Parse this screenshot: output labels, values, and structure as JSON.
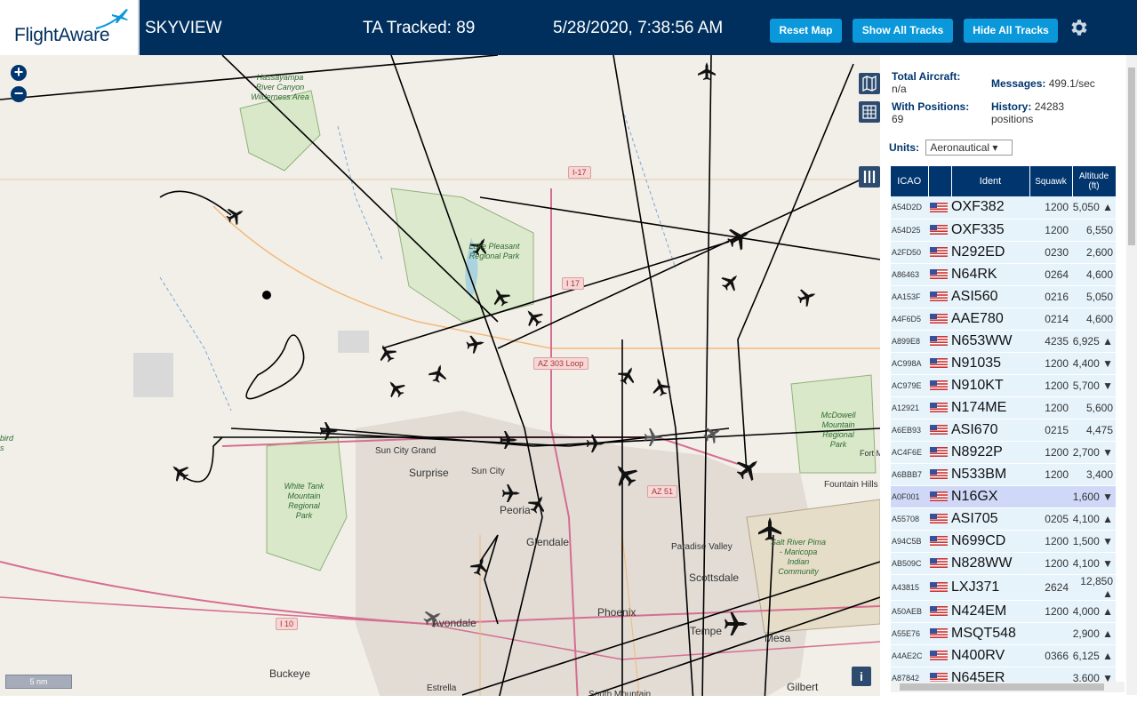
{
  "header": {
    "logo_text": "FlightAware",
    "app_title": "SKYVIEW",
    "ta_tracked": "TA Tracked: 89",
    "datetime": "5/28/2020, 7:38:56 AM",
    "reset_label": "Reset Map",
    "show_tracks_label": "Show All Tracks",
    "hide_tracks_label": "Hide All Tracks",
    "settings_icon": "gear-icon"
  },
  "map": {
    "zoom_in": "+",
    "zoom_out": "−",
    "scale": "5 nm",
    "info": "i",
    "shields": [
      "I-17",
      "I 17",
      "AZ 303 Loop",
      "AZ 51",
      "I 10"
    ],
    "places": [
      "Sun City Grand",
      "Surprise",
      "Sun City",
      "Peoria",
      "Glendale",
      "Paradise Valley",
      "Scottsdale",
      "Phoenix",
      "Avondale",
      "Tempe",
      "Mesa",
      "Gilbert",
      "Buckeye",
      "Fountain Hills",
      "Fort M",
      "Estrella",
      "South Mountain"
    ],
    "parks": [
      "Hassayampa River Canyon Wilderness Area",
      "Lake Pleasant Regional Park",
      "White Tank Mountain Regional Park",
      "McDowell Mountain Regional Park",
      "Salt River Pima - Maricopa Indian Community",
      "bird s"
    ]
  },
  "stats": {
    "total_aircraft_label": "Total Aircraft:",
    "total_aircraft_value": "n/a",
    "with_positions_label": "With Positions:",
    "with_positions_value": "69",
    "messages_label": "Messages:",
    "messages_value": "499.1/sec",
    "history_label": "History:",
    "history_value": "24283",
    "history_unit": "positions",
    "units_label": "Units:",
    "units_value": "Aeronautical ▾"
  },
  "table": {
    "headers": [
      "ICAO",
      "",
      "Ident",
      "Squawk",
      "Altitude (ft)"
    ],
    "rows": [
      {
        "icao": "A54D2D",
        "ident": "OXF382",
        "squawk": "1200",
        "alt": "5,050 ▲"
      },
      {
        "icao": "A54D25",
        "ident": "OXF335",
        "squawk": "1200",
        "alt": "6,550"
      },
      {
        "icao": "A2FD50",
        "ident": "N292ED",
        "squawk": "0230",
        "alt": "2,600"
      },
      {
        "icao": "A86463",
        "ident": "N64RK",
        "squawk": "0264",
        "alt": "4,600"
      },
      {
        "icao": "AA153F",
        "ident": "ASI560",
        "squawk": "0216",
        "alt": "5,050"
      },
      {
        "icao": "A4F6D5",
        "ident": "AAE780",
        "squawk": "0214",
        "alt": "4,600"
      },
      {
        "icao": "A899E8",
        "ident": "N653WW",
        "squawk": "4235",
        "alt": "6,925 ▲"
      },
      {
        "icao": "AC998A",
        "ident": "N91035",
        "squawk": "1200",
        "alt": "4,400 ▼"
      },
      {
        "icao": "AC979E",
        "ident": "N910KT",
        "squawk": "1200",
        "alt": "5,700 ▼"
      },
      {
        "icao": "A12921",
        "ident": "N174ME",
        "squawk": "1200",
        "alt": "5,600"
      },
      {
        "icao": "A6EB93",
        "ident": "ASI670",
        "squawk": "0215",
        "alt": "4,475"
      },
      {
        "icao": "AC4F6E",
        "ident": "N8922P",
        "squawk": "1200",
        "alt": "2,700 ▼"
      },
      {
        "icao": "A6BBB7",
        "ident": "N533BM",
        "squawk": "1200",
        "alt": "3,400"
      },
      {
        "icao": "A0F001",
        "ident": "N16GX",
        "squawk": "",
        "alt": "1,600 ▼",
        "selected": true
      },
      {
        "icao": "A55708",
        "ident": "ASI705",
        "squawk": "0205",
        "alt": "4,100 ▲"
      },
      {
        "icao": "A94C5B",
        "ident": "N699CD",
        "squawk": "1200",
        "alt": "1,500 ▼"
      },
      {
        "icao": "AB509C",
        "ident": "N828WW",
        "squawk": "1200",
        "alt": "4,100 ▼"
      },
      {
        "icao": "A43815",
        "ident": "LXJ371",
        "squawk": "2624",
        "alt": "12,850 ▲"
      },
      {
        "icao": "A50AEB",
        "ident": "N424EM",
        "squawk": "1200",
        "alt": "4,000 ▲"
      },
      {
        "icao": "A55E76",
        "ident": "MSQT548",
        "squawk": "",
        "alt": "2,900 ▲"
      },
      {
        "icao": "A4AE2C",
        "ident": "N400RV",
        "squawk": "0366",
        "alt": "6,125 ▲"
      },
      {
        "icao": "A87842",
        "ident": "N645ER",
        "squawk": "",
        "alt": "3,600 ▼"
      }
    ]
  },
  "colors": {
    "header_bg": "#002f5d",
    "button_bg": "#0a98db",
    "table_header": "#00356e",
    "row_bg": "#e6f3fb",
    "row_selected": "#d0d8f8"
  }
}
